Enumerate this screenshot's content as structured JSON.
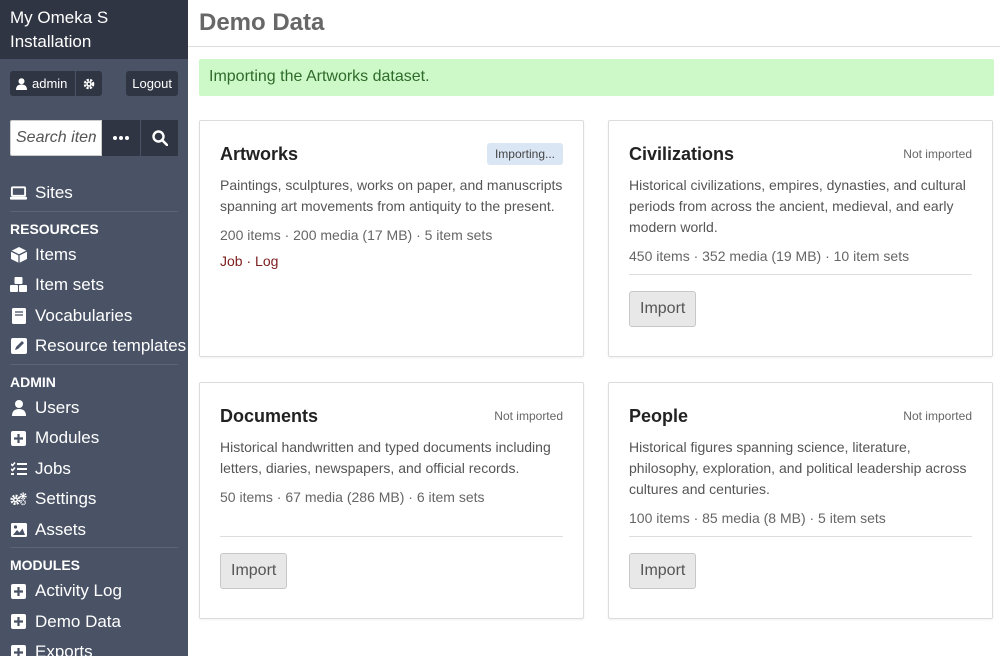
{
  "sidebar": {
    "brand_line1": "My Omeka S",
    "brand_line2": "Installation",
    "user_label": "admin",
    "logout_label": "Logout",
    "search_placeholder": "Search items",
    "sites_label": "Sites",
    "resources_heading": "RESOURCES",
    "resources": [
      "Items",
      "Item sets",
      "Vocabularies",
      "Resource templates"
    ],
    "admin_heading": "ADMIN",
    "admin": [
      "Users",
      "Modules",
      "Jobs",
      "Settings",
      "Assets"
    ],
    "modules_heading": "MODULES",
    "modules": [
      "Activity Log",
      "Demo Data",
      "Exports"
    ]
  },
  "page": {
    "title": "Demo Data",
    "flash": "Importing the Artworks dataset."
  },
  "datasets": [
    {
      "name": "Artworks",
      "status": "Importing...",
      "description": "Paintings, sculptures, works on paper, and manuscripts spanning art movements from antiquity to the present.",
      "meta": "200 items · 200 media (17 MB) · 5 item sets",
      "job_label": "Job",
      "link_sep": " · ",
      "log_label": "Log"
    },
    {
      "name": "Civilizations",
      "status": "Not imported",
      "description": "Historical civilizations, empires, dynasties, and cultural periods from across the ancient, medieval, and early modern world.",
      "meta": "450 items · 352 media (19 MB) · 10 item sets",
      "import_label": "Import"
    },
    {
      "name": "Documents",
      "status": "Not imported",
      "description": "Historical handwritten and typed documents including letters, diaries, newspapers, and official records.",
      "meta": "50 items · 67 media (286 MB) · 6 item sets",
      "import_label": "Import"
    },
    {
      "name": "People",
      "status": "Not imported",
      "description": "Historical figures spanning science, literature, philosophy, exploration, and political leadership across cultures and centuries.",
      "meta": "100 items · 85 media (8 MB) · 5 item sets",
      "import_label": "Import"
    }
  ]
}
